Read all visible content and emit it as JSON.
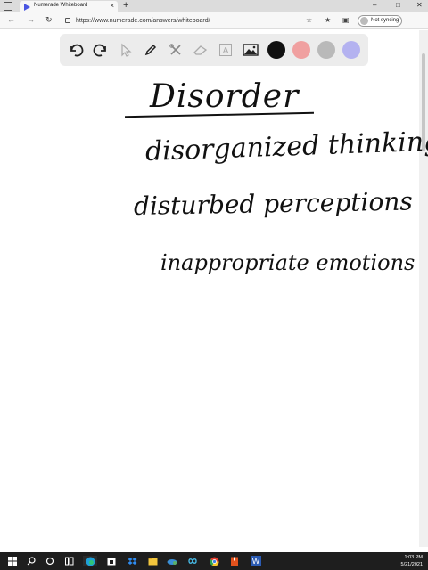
{
  "browser": {
    "tab_title": "Numerade Whiteboard",
    "tab_close": "×",
    "new_tab": "+",
    "url": "https://www.numerade.com/answers/whiteboard/",
    "sync_label": "Not syncing",
    "window_controls": {
      "minimize": "–",
      "maximize": "□",
      "close": "✕"
    },
    "nav": {
      "back": "←",
      "forward": "→",
      "refresh": "↻"
    },
    "menu": "⋯"
  },
  "toolbar": {
    "tools": [
      "undo-icon",
      "redo-icon",
      "pointer-icon",
      "pen-icon",
      "tools-icon",
      "eraser-icon",
      "text-icon",
      "image-icon"
    ],
    "colors": [
      "#111111",
      "#f0a0a0",
      "#b9b9b9",
      "#b4b2f0"
    ]
  },
  "whiteboard": {
    "heading": "Disorder",
    "lines": [
      "disorganized thinking",
      "disturbed perceptions",
      "inappropriate emotions"
    ]
  },
  "taskbar": {
    "time": "1:03 PM",
    "date": "5/21/2021",
    "word_label": "W"
  }
}
